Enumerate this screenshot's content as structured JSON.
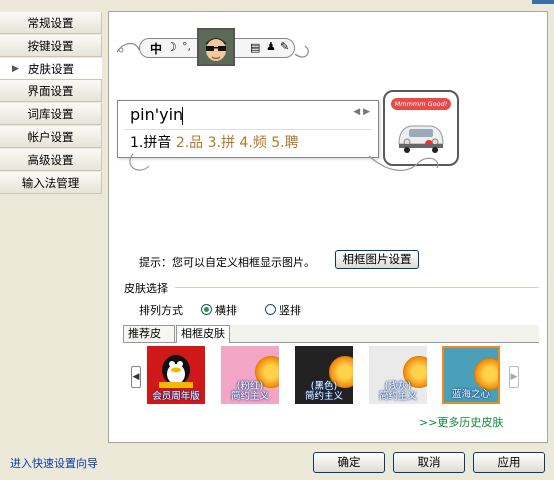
{
  "sidebar": {
    "items": [
      {
        "label": "常规设置"
      },
      {
        "label": "按键设置"
      },
      {
        "label": "皮肤设置",
        "active": true
      },
      {
        "label": "界面设置"
      },
      {
        "label": "词库设置"
      },
      {
        "label": "帐户设置"
      },
      {
        "label": "高级设置"
      },
      {
        "label": "输入法管理"
      }
    ]
  },
  "preview": {
    "status_bar_zh": "中",
    "input_text": "pin'yin",
    "candidate_first": "1.拼音",
    "candidate_rest": "2.品 3.拼 4.频 5.聘",
    "card_tag": "Mmmmm Good!"
  },
  "frame_hint": {
    "text": "提示：您可以自定义相框显示图片。",
    "button_label": "相框图片设置"
  },
  "skin_select": {
    "group_label": "皮肤选择",
    "sort_label": "排列方式",
    "sort_options": [
      {
        "label": "横排",
        "checked": true
      },
      {
        "label": "竖排",
        "checked": false
      }
    ],
    "tabs": [
      {
        "label": "推荐皮肤",
        "active": false
      },
      {
        "label": "相框皮肤",
        "active": true
      }
    ],
    "skins": [
      {
        "caption": "会员周年版"
      },
      {
        "caption_top": "(粉红)",
        "caption": "简约主义"
      },
      {
        "caption_top": "(黑色)",
        "caption": "简约主义"
      },
      {
        "caption_top": "(浅灰)",
        "caption": "简约主义"
      },
      {
        "caption": "蓝海之心",
        "selected": true
      }
    ],
    "more_link": ">>更多历史皮肤"
  },
  "footer": {
    "wizard_link": "进入快速设置向导",
    "ok": "确定",
    "cancel": "取消",
    "apply": "应用"
  },
  "colors": {
    "window_bg": "#ece9d8",
    "selected_skin_border": "#f08a20",
    "link_green": "#0a8a3a",
    "link_blue": "#0b3ba8"
  }
}
